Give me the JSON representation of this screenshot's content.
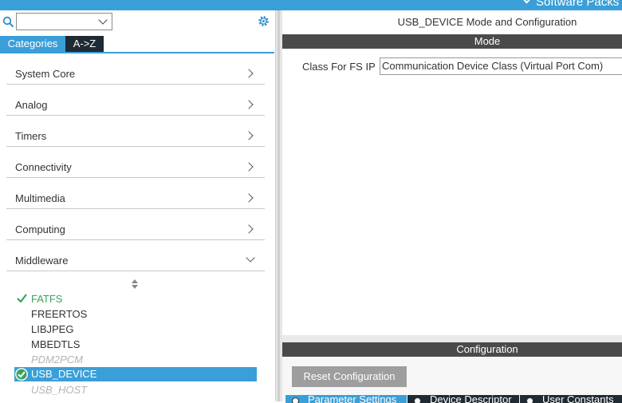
{
  "topbar": {
    "software_packs_label": "Software Packs"
  },
  "left_panel": {
    "search_dropdown_value": "",
    "tabs": {
      "categories": "Categories",
      "az": "A->Z"
    },
    "categories": [
      {
        "label": "System Core"
      },
      {
        "label": "Analog"
      },
      {
        "label": "Timers"
      },
      {
        "label": "Connectivity"
      },
      {
        "label": "Multimedia"
      },
      {
        "label": "Computing"
      },
      {
        "label": "Middleware"
      }
    ],
    "middleware_items": [
      {
        "label": "FATFS",
        "state": "enabled-ok"
      },
      {
        "label": "FREERTOS",
        "state": "normal"
      },
      {
        "label": "LIBJPEG",
        "state": "normal"
      },
      {
        "label": "MBEDTLS",
        "state": "normal"
      },
      {
        "label": "PDM2PCM",
        "state": "disabled"
      },
      {
        "label": "USB_DEVICE",
        "state": "selected"
      },
      {
        "label": "USB_HOST",
        "state": "disabled"
      }
    ]
  },
  "right_panel": {
    "title": "USB_DEVICE Mode and Configuration",
    "mode_header": "Mode",
    "class_field": {
      "label": "Class For FS IP",
      "value": "Communication Device Class (Virtual Port Com)"
    },
    "configuration_header": "Configuration",
    "reset_button": "Reset Configuration",
    "config_tabs": [
      "Parameter Settings",
      "Device Descriptor",
      "User Constants"
    ]
  },
  "colors": {
    "accent": "#3a9fd8",
    "dark": "#1f2a33",
    "header_bar": "#4a4a4a",
    "ok_green": "#3aa35e"
  }
}
